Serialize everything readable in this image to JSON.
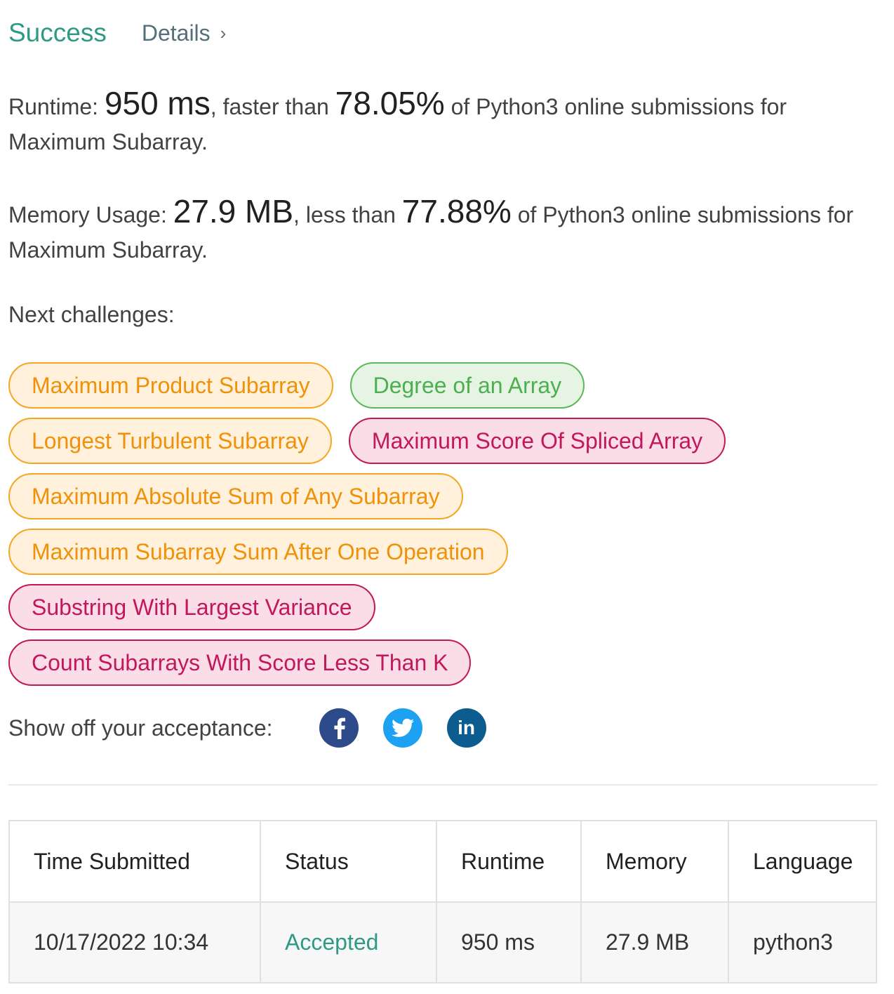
{
  "header": {
    "status": "Success",
    "details_label": "Details",
    "chevron_icon": "chevron-right-icon"
  },
  "runtime": {
    "label": "Runtime: ",
    "value": "950 ms",
    "mid": ", faster than ",
    "percent": "78.05%",
    "tail": " of Python3 online submissions for Maximum Subarray."
  },
  "memory": {
    "label": "Memory Usage: ",
    "value": "27.9 MB",
    "mid": ", less than ",
    "percent": "77.88%",
    "tail": " of Python3 online submissions for Maximum Subarray."
  },
  "next": {
    "label": "Next challenges:",
    "challenges": [
      {
        "title": "Maximum Product Subarray",
        "difficulty": "medium"
      },
      {
        "title": "Degree of an Array",
        "difficulty": "easy"
      },
      {
        "title": "Longest Turbulent Subarray",
        "difficulty": "medium"
      },
      {
        "title": "Maximum Score Of Spliced Array",
        "difficulty": "hard"
      },
      {
        "title": "Maximum Absolute Sum of Any Subarray",
        "difficulty": "medium"
      },
      {
        "title": "Maximum Subarray Sum After One Operation",
        "difficulty": "medium"
      },
      {
        "title": "Substring With Largest Variance",
        "difficulty": "hard"
      },
      {
        "title": "Count Subarrays With Score Less Than K",
        "difficulty": "hard"
      }
    ]
  },
  "share": {
    "label": "Show off your acceptance:",
    "icons": [
      "facebook-icon",
      "twitter-icon",
      "linkedin-icon"
    ],
    "linkedin_text": "in"
  },
  "table": {
    "headers": [
      "Time Submitted",
      "Status",
      "Runtime",
      "Memory",
      "Language"
    ],
    "rows": [
      [
        "10/17/2022 10:34",
        "Accepted",
        "950 ms",
        "27.9 MB",
        "python3"
      ]
    ]
  },
  "colors": {
    "success": "#2e9a84",
    "medium": "#f0910a",
    "easy": "#4caf50",
    "hard": "#c2185b",
    "facebook": "#2d4a8a",
    "twitter": "#1da1f2",
    "linkedin": "#0d5c8f"
  }
}
